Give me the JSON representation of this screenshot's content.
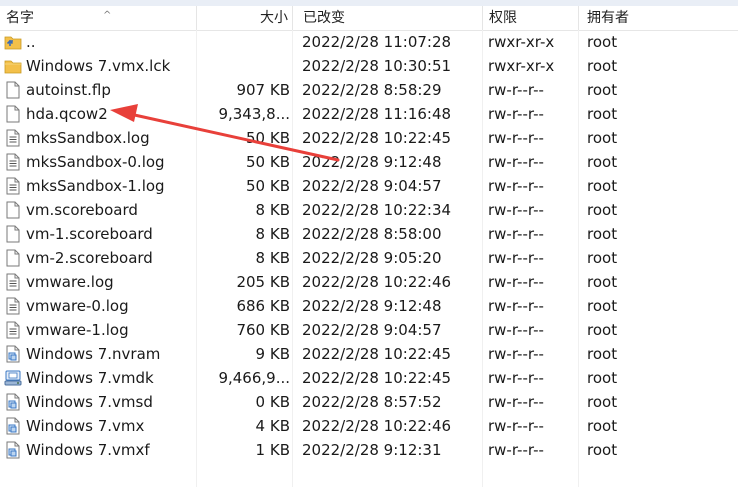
{
  "columns": {
    "name": "名字",
    "size": "大小",
    "modified": "已改变",
    "permissions": "权限",
    "owner": "拥有者"
  },
  "sort_indicator": "^",
  "files": [
    {
      "icon": "parent-folder-icon",
      "name": "..",
      "size": "",
      "modified": "2022/2/28 11:07:28",
      "permissions": "rwxr-xr-x",
      "owner": "root"
    },
    {
      "icon": "folder-icon",
      "name": "Windows 7.vmx.lck",
      "size": "",
      "modified": "2022/2/28 10:30:51",
      "permissions": "rwxr-xr-x",
      "owner": "root"
    },
    {
      "icon": "file-icon",
      "name": "autoinst.flp",
      "size": "907 KB",
      "modified": "2022/2/28 8:58:29",
      "permissions": "rw-r--r--",
      "owner": "root"
    },
    {
      "icon": "file-icon",
      "name": "hda.qcow2",
      "size": "9,343,8...",
      "modified": "2022/2/28 11:16:48",
      "permissions": "rw-r--r--",
      "owner": "root"
    },
    {
      "icon": "text-file-icon",
      "name": "mksSandbox.log",
      "size": "50 KB",
      "modified": "2022/2/28 10:22:45",
      "permissions": "rw-r--r--",
      "owner": "root"
    },
    {
      "icon": "text-file-icon",
      "name": "mksSandbox-0.log",
      "size": "50 KB",
      "modified": "2022/2/28 9:12:48",
      "permissions": "rw-r--r--",
      "owner": "root"
    },
    {
      "icon": "text-file-icon",
      "name": "mksSandbox-1.log",
      "size": "50 KB",
      "modified": "2022/2/28 9:04:57",
      "permissions": "rw-r--r--",
      "owner": "root"
    },
    {
      "icon": "file-icon",
      "name": "vm.scoreboard",
      "size": "8 KB",
      "modified": "2022/2/28 10:22:34",
      "permissions": "rw-r--r--",
      "owner": "root"
    },
    {
      "icon": "file-icon",
      "name": "vm-1.scoreboard",
      "size": "8 KB",
      "modified": "2022/2/28 8:58:00",
      "permissions": "rw-r--r--",
      "owner": "root"
    },
    {
      "icon": "file-icon",
      "name": "vm-2.scoreboard",
      "size": "8 KB",
      "modified": "2022/2/28 9:05:20",
      "permissions": "rw-r--r--",
      "owner": "root"
    },
    {
      "icon": "text-file-icon",
      "name": "vmware.log",
      "size": "205 KB",
      "modified": "2022/2/28 10:22:46",
      "permissions": "rw-r--r--",
      "owner": "root"
    },
    {
      "icon": "text-file-icon",
      "name": "vmware-0.log",
      "size": "686 KB",
      "modified": "2022/2/28 9:12:48",
      "permissions": "rw-r--r--",
      "owner": "root"
    },
    {
      "icon": "text-file-icon",
      "name": "vmware-1.log",
      "size": "760 KB",
      "modified": "2022/2/28 9:04:57",
      "permissions": "rw-r--r--",
      "owner": "root"
    },
    {
      "icon": "vmware-file-icon",
      "name": "Windows 7.nvram",
      "size": "9 KB",
      "modified": "2022/2/28 10:22:45",
      "permissions": "rw-r--r--",
      "owner": "root"
    },
    {
      "icon": "virtual-disk-icon",
      "name": "Windows 7.vmdk",
      "size": "9,466,9...",
      "modified": "2022/2/28 10:22:45",
      "permissions": "rw-r--r--",
      "owner": "root"
    },
    {
      "icon": "vmware-file-icon",
      "name": "Windows 7.vmsd",
      "size": "0 KB",
      "modified": "2022/2/28 8:57:52",
      "permissions": "rw-r--r--",
      "owner": "root"
    },
    {
      "icon": "vmware-file-icon",
      "name": "Windows 7.vmx",
      "size": "4 KB",
      "modified": "2022/2/28 10:22:46",
      "permissions": "rw-r--r--",
      "owner": "root"
    },
    {
      "icon": "vmware-file-icon",
      "name": "Windows 7.vmxf",
      "size": "1 KB",
      "modified": "2022/2/28 9:12:31",
      "permissions": "rw-r--r--",
      "owner": "root"
    }
  ],
  "annotation": {
    "arrow_color": "#e8403a",
    "points_to": "hda.qcow2"
  }
}
